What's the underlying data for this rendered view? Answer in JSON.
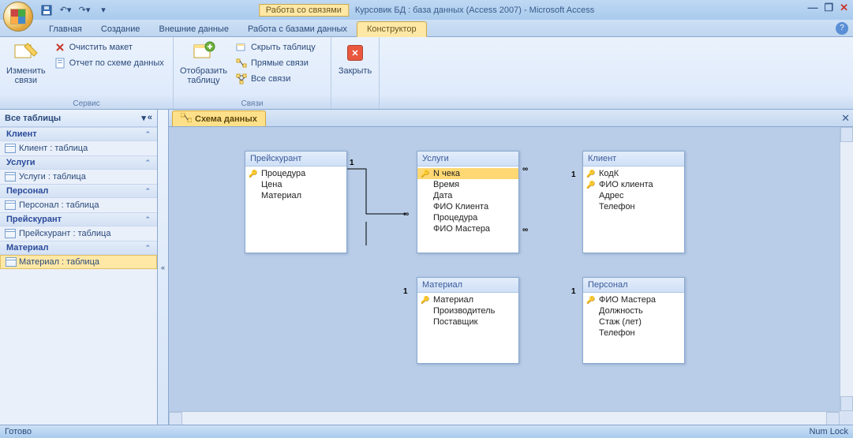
{
  "titlebar": {
    "context_label": "Работа со связями",
    "title": "Курсовик БД : база данных (Access 2007) - Microsoft Access"
  },
  "ribbon_tabs": [
    "Главная",
    "Создание",
    "Внешние данные",
    "Работа с базами данных"
  ],
  "ribbon_ctx_tab": "Конструктор",
  "ribbon": {
    "group1": {
      "edit_rel": "Изменить\nсвязи",
      "clear_layout": "Очистить макет",
      "rel_report": "Отчет по схеме данных",
      "label": "Сервис"
    },
    "group2": {
      "show_table": "Отобразить\nтаблицу",
      "hide_table": "Скрыть таблицу",
      "direct_rel": "Прямые связи",
      "all_rel": "Все связи",
      "label": "Связи"
    },
    "group3": {
      "close": "Закрыть"
    }
  },
  "nav": {
    "header": "Все таблицы",
    "groups": [
      {
        "name": "Клиент",
        "items": [
          "Клиент : таблица"
        ]
      },
      {
        "name": "Услуги",
        "items": [
          "Услуги : таблица"
        ]
      },
      {
        "name": "Персонал",
        "items": [
          "Персонал : таблица"
        ]
      },
      {
        "name": "Прейскурант",
        "items": [
          "Прейскурант : таблица"
        ]
      },
      {
        "name": "Материал",
        "items": [
          "Материал : таблица"
        ]
      }
    ],
    "selected": "Материал : таблица"
  },
  "doc_tab": "Схема данных",
  "tables": {
    "preiskurant": {
      "title": "Прейскурант",
      "fields": [
        [
          "Процедура",
          true
        ],
        [
          "Цена",
          false
        ],
        [
          "Материал",
          false
        ]
      ]
    },
    "uslugi": {
      "title": "Услуги",
      "fields": [
        [
          "N чека",
          true
        ],
        [
          "Время",
          false
        ],
        [
          "Дата",
          false
        ],
        [
          "ФИО Клиента",
          false
        ],
        [
          "Процедура",
          false
        ],
        [
          "ФИО Мастера",
          false
        ]
      ]
    },
    "klient": {
      "title": "Клиент",
      "fields": [
        [
          "КодК",
          true
        ],
        [
          "ФИО клиента",
          true
        ],
        [
          "Адрес",
          false
        ],
        [
          "Телефон",
          false
        ]
      ]
    },
    "material": {
      "title": "Материал",
      "fields": [
        [
          "Материал",
          true
        ],
        [
          "Производитель",
          false
        ],
        [
          "Поставщик",
          false
        ]
      ]
    },
    "personal": {
      "title": "Персонал",
      "fields": [
        [
          "ФИО Мастера",
          true
        ],
        [
          "Должность",
          false
        ],
        [
          "Стаж (лет)",
          false
        ],
        [
          "Телефон",
          false
        ]
      ]
    }
  },
  "rel_labels": {
    "one": "1",
    "many": "∞"
  },
  "statusbar": {
    "left": "Готово",
    "right": "Num Lock"
  }
}
